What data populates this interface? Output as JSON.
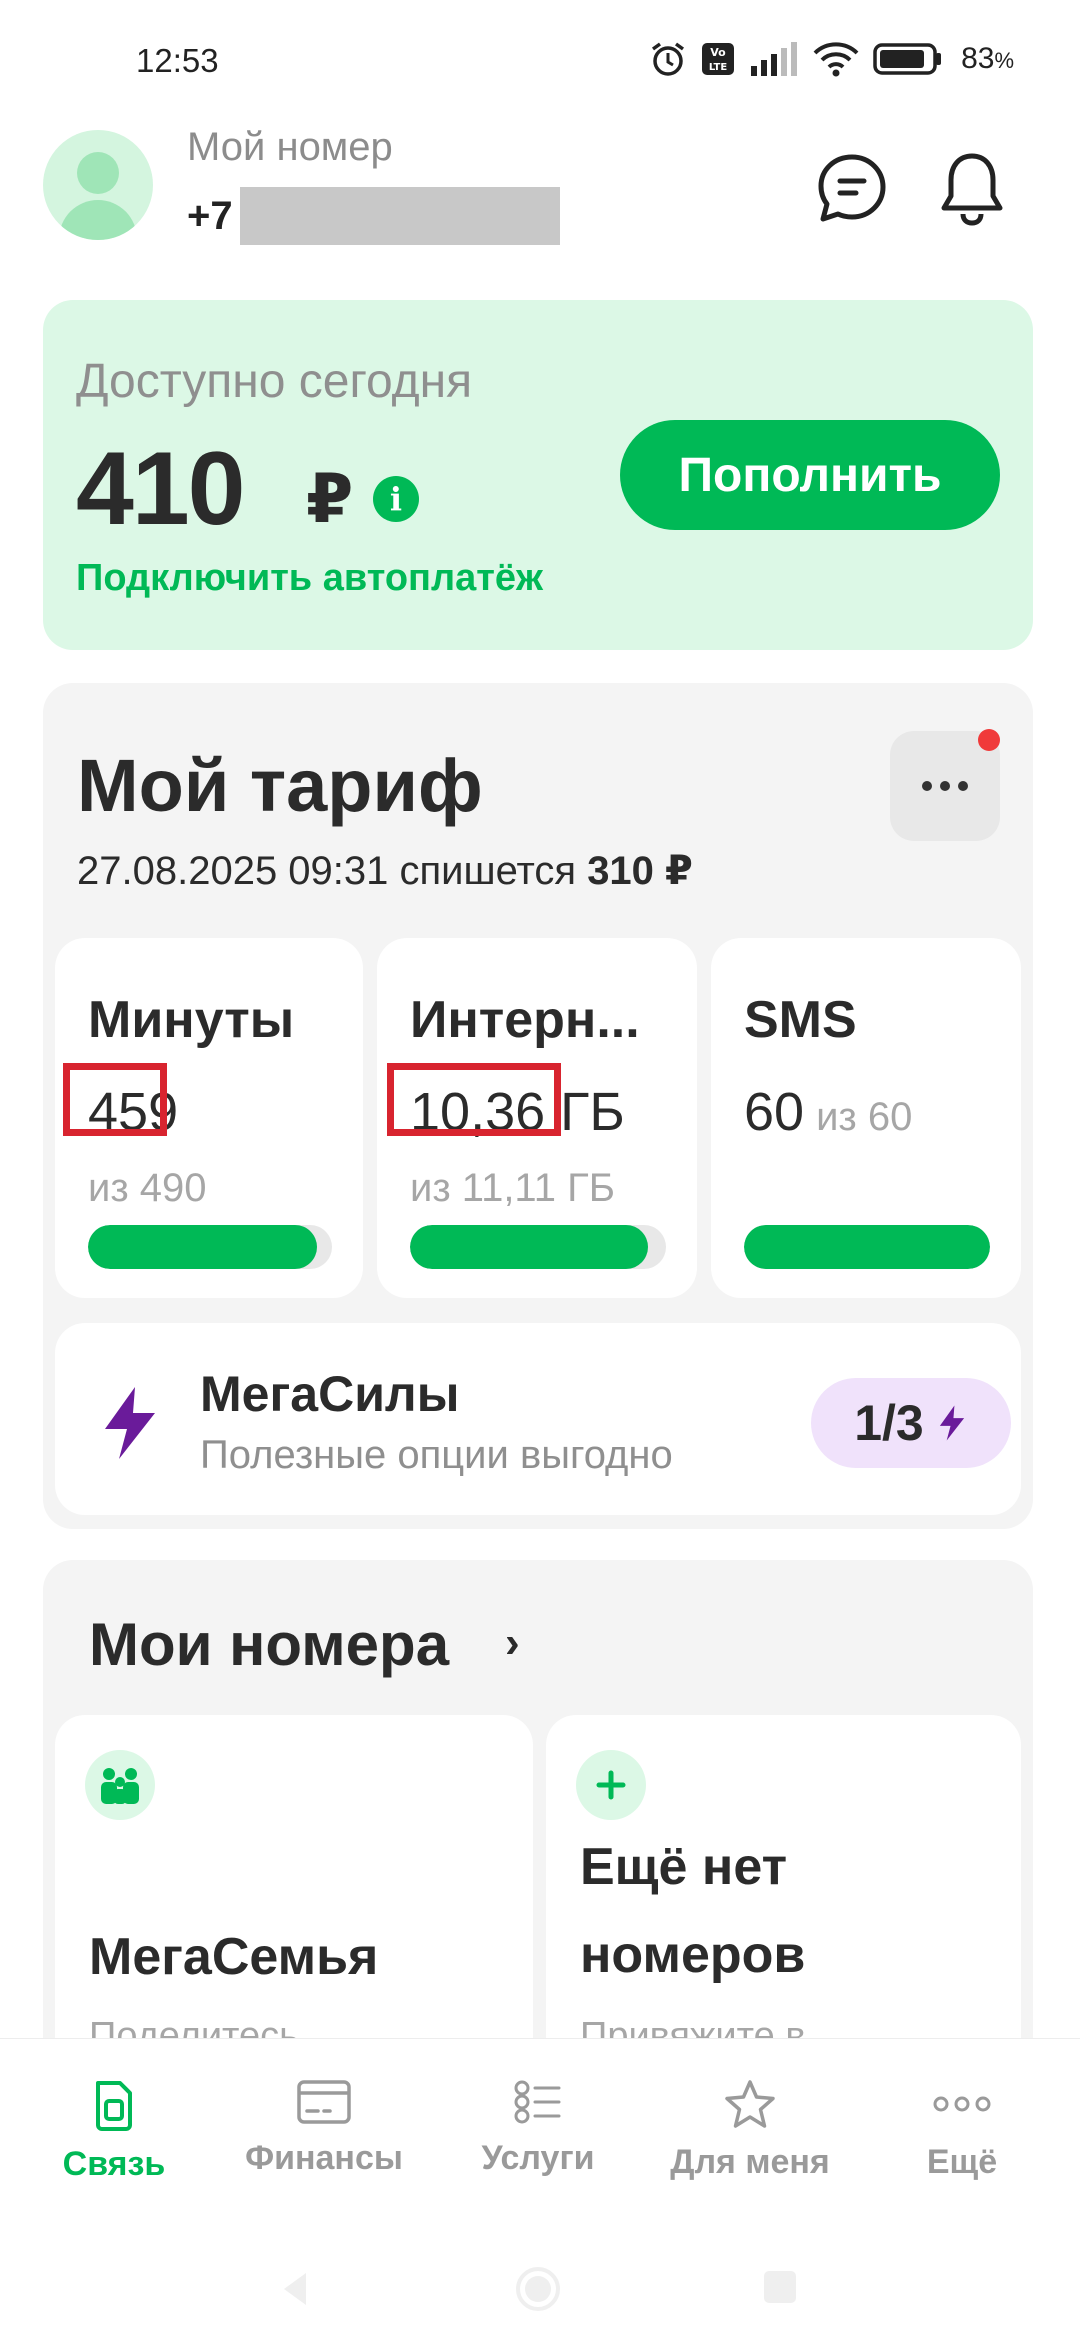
{
  "status_bar": {
    "time": "12:53",
    "battery_percent": "83",
    "battery_unit": "%",
    "icons": [
      "alarm-icon",
      "volte-icon",
      "signal-icon",
      "wifi-icon",
      "battery-icon"
    ]
  },
  "header": {
    "my_number_label": "Мой номер",
    "phone_prefix": "+7",
    "icons": [
      "chat-icon",
      "bell-icon"
    ]
  },
  "balance": {
    "label": "Доступно сегодня",
    "amount": "410",
    "currency": "₽",
    "topup_label": "Пополнить",
    "autopay_link": "Подключить автоплатёж"
  },
  "tariff": {
    "title": "Мой тариф",
    "charge_text": "27.08.2025 09:31 спишется",
    "charge_amount": "310 ₽",
    "quotas": [
      {
        "title": "Минуты",
        "value": "459",
        "total": "из 490",
        "fill_fraction": 0.94
      },
      {
        "title": "Интерн...",
        "value": "10,36 ГБ",
        "total": "из 11,11 ГБ",
        "fill_fraction": 0.93
      },
      {
        "title": "SMS",
        "value": "60",
        "total": "из 60",
        "fill_fraction": 1.0
      }
    ],
    "megasily": {
      "title": "МегаСилы",
      "subtitle": "Полезные опции выгодно",
      "progress": "1/3"
    }
  },
  "my_numbers": {
    "title": "Мои номера",
    "chevron": "›",
    "tiles": [
      {
        "title": "МегаСемья",
        "subtitle": "Поделитесь"
      },
      {
        "title_line1": "Ещё нет",
        "title_line2": "номеров",
        "subtitle": "Привяжите в"
      }
    ]
  },
  "bottom_nav": [
    {
      "label": "Связь",
      "icon": "sim-icon",
      "active": true
    },
    {
      "label": "Финансы",
      "icon": "card-icon",
      "active": false
    },
    {
      "label": "Услуги",
      "icon": "services-list-icon",
      "active": false
    },
    {
      "label": "Для меня",
      "icon": "star-icon",
      "active": false
    },
    {
      "label": "Ещё",
      "icon": "more-dots-icon",
      "active": false
    }
  ],
  "colors": {
    "brand_green": "#00b956",
    "balance_card_bg": "#dcf8e6",
    "highlight_red": "#d8242f",
    "megasily_purple": "#6a1b9a"
  }
}
